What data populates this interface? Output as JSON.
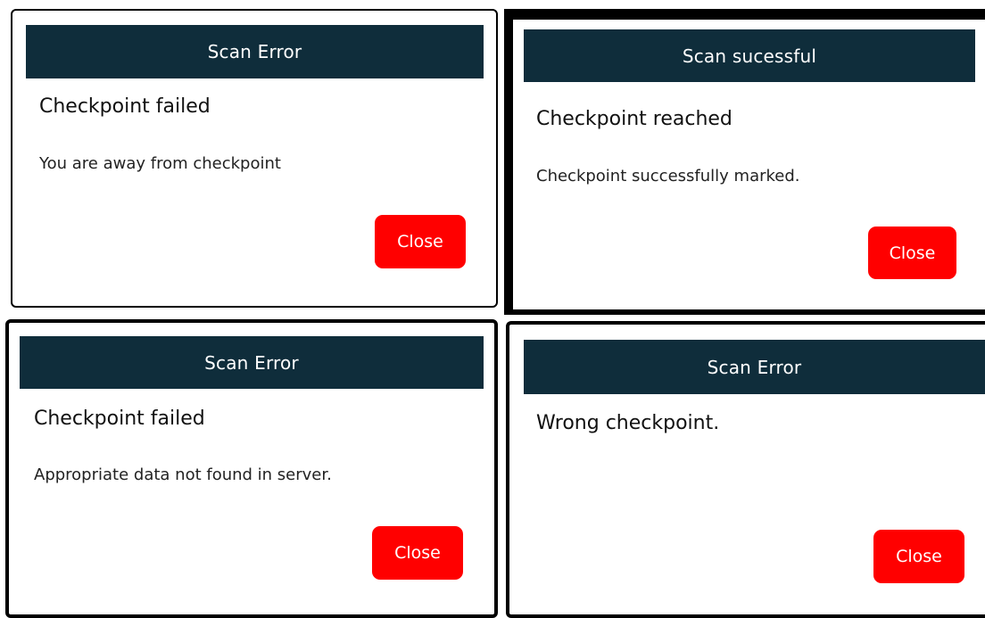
{
  "colors": {
    "header_background": "#0f2d3b",
    "header_text": "#ffffff",
    "close_button_background": "#ff0000",
    "close_button_text": "#ffffff"
  },
  "dialogs": [
    {
      "title": "Scan Error",
      "heading": "Checkpoint failed",
      "message": "You are away from checkpoint",
      "close_label": "Close"
    },
    {
      "title": "Scan sucessful",
      "heading": "Checkpoint reached",
      "message": "Checkpoint successfully marked.",
      "close_label": "Close"
    },
    {
      "title": "Scan Error",
      "heading": "Checkpoint failed",
      "message": "Appropriate data not found in server.",
      "close_label": "Close"
    },
    {
      "title": "Scan Error",
      "heading": "Wrong checkpoint.",
      "message": "",
      "close_label": "Close"
    }
  ]
}
